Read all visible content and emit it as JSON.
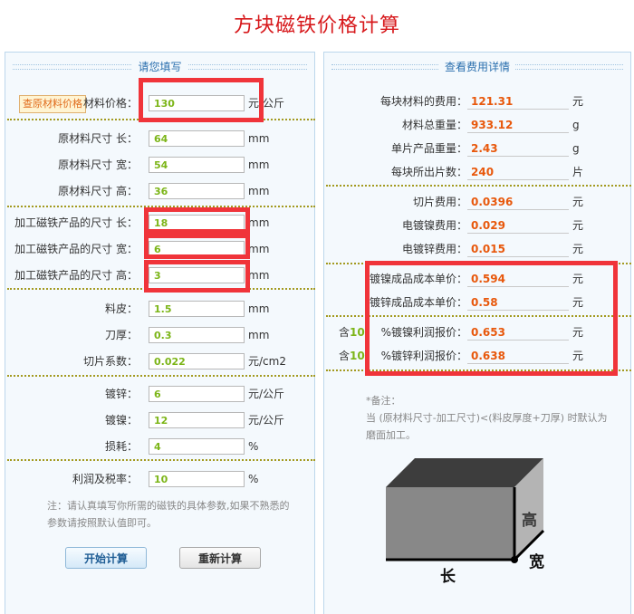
{
  "title": "方块磁铁价格计算",
  "left": {
    "heading": "请您填写",
    "lookup_button": "查原材料价格",
    "fields": [
      {
        "key": "material_price",
        "label": "材料价格：",
        "value": "130",
        "unit": "元/公斤"
      },
      {
        "key": "raw_length",
        "label": "原材料尺寸 长：",
        "value": "64",
        "unit": "mm"
      },
      {
        "key": "raw_width",
        "label": "原材料尺寸 宽：",
        "value": "54",
        "unit": "mm"
      },
      {
        "key": "raw_height",
        "label": "原材料尺寸 高：",
        "value": "36",
        "unit": "mm"
      },
      {
        "key": "prod_length",
        "label": "加工磁铁产品的尺寸 长：",
        "value": "18",
        "unit": "mm"
      },
      {
        "key": "prod_width",
        "label": "加工磁铁产品的尺寸 宽：",
        "value": "6",
        "unit": "mm"
      },
      {
        "key": "prod_height",
        "label": "加工磁铁产品的尺寸 高：",
        "value": "3",
        "unit": "mm"
      },
      {
        "key": "skin",
        "label": "料皮：",
        "value": "1.5",
        "unit": "mm"
      },
      {
        "key": "blade",
        "label": "刀厚：",
        "value": "0.3",
        "unit": "mm"
      },
      {
        "key": "cut_coef",
        "label": "切片系数：",
        "value": "0.022",
        "unit": "元/cm2"
      },
      {
        "key": "zinc",
        "label": "镀锌：",
        "value": "6",
        "unit": "元/公斤"
      },
      {
        "key": "nickel",
        "label": "镀镍：",
        "value": "12",
        "unit": "元/公斤"
      },
      {
        "key": "loss",
        "label": "损耗：",
        "value": "4",
        "unit": "%"
      },
      {
        "key": "profit_tax",
        "label": "利润及税率：",
        "value": "10",
        "unit": "%"
      }
    ],
    "note": "注：请认真填写你所需的磁铁的具体参数,如果不熟悉的参数请按照默认值即可。",
    "calc_button": "开始计算",
    "reset_button": "重新计算"
  },
  "right": {
    "heading": "查看费用详情",
    "results": [
      {
        "key": "material_cost",
        "label": "每块材料的费用：",
        "value": "121.31",
        "unit": "元"
      },
      {
        "key": "total_weight",
        "label": "材料总重量：",
        "value": "933.12",
        "unit": "g"
      },
      {
        "key": "piece_weight",
        "label": "单片产品重量：",
        "value": "2.43",
        "unit": "g"
      },
      {
        "key": "pieces",
        "label": "每块所出片数：",
        "value": "240",
        "unit": "片"
      },
      {
        "key": "cut_cost",
        "label": "切片费用：",
        "value": "0.0396",
        "unit": "元"
      },
      {
        "key": "ni_cost",
        "label": "电镀镍费用：",
        "value": "0.029",
        "unit": "元"
      },
      {
        "key": "zn_cost",
        "label": "电镀锌费用：",
        "value": "0.015",
        "unit": "元"
      },
      {
        "key": "ni_unit",
        "label": "镀镍成品成本单价：",
        "value": "0.594",
        "unit": "元"
      },
      {
        "key": "zn_unit",
        "label": "镀锌成品成本单价：",
        "value": "0.58",
        "unit": "元"
      },
      {
        "key": "ni_quote",
        "label": "%镀镍利润报价：",
        "value": "0.653",
        "unit": "元"
      },
      {
        "key": "zn_quote",
        "label": "%镀锌利润报价：",
        "value": "0.638",
        "unit": "元"
      }
    ],
    "quote_prefix": "含",
    "quote_percent": "10",
    "note_title": "*备注：",
    "note_text": "当 (原材料尺寸-加工尺寸)<(料皮厚度+刀厚) 时默认为磨面加工。",
    "diagram": {
      "height_label": "高",
      "width_label": "宽",
      "length_label": "长"
    }
  }
}
